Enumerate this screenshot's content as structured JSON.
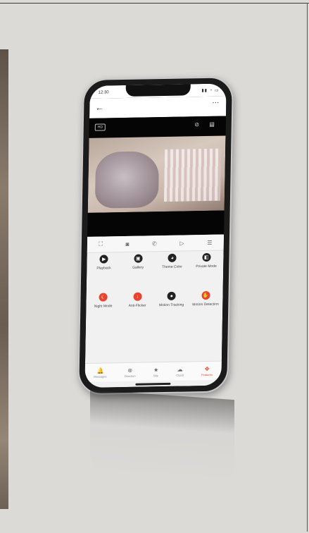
{
  "status_bar": {
    "time": "12:30",
    "icons": "▮▮ ◔ ▭"
  },
  "app_bar": {
    "back_glyph": "←",
    "more_glyph": "⋯"
  },
  "camera_header": {
    "quality_label": "HD",
    "icon_glyphs": "⊘ ▤"
  },
  "toolbar": {
    "items": [
      {
        "name": "fullscreen-icon",
        "glyph": "⛶"
      },
      {
        "name": "snapshot-icon",
        "glyph": "◙"
      },
      {
        "name": "call-icon",
        "glyph": "✆"
      },
      {
        "name": "record-icon",
        "glyph": "▷"
      },
      {
        "name": "menu-icon",
        "glyph": "☰"
      }
    ]
  },
  "features": [
    {
      "label": "Playback",
      "glyph": "▶",
      "accent": false
    },
    {
      "label": "Gallery",
      "glyph": "▣",
      "accent": false
    },
    {
      "label": "Theme Color",
      "glyph": "◕",
      "accent": false
    },
    {
      "label": "Private Mode",
      "glyph": "◧",
      "accent": false
    },
    {
      "label": "Night Mode",
      "glyph": "☾",
      "accent": true
    },
    {
      "label": "Anti-Flicker",
      "glyph": "↓",
      "accent": true
    },
    {
      "label": "Motion Tracking",
      "glyph": "●",
      "accent": false
    },
    {
      "label": "Motion Detection",
      "glyph": "✋",
      "accent": true
    }
  ],
  "tabs": [
    {
      "label": "Messages",
      "glyph": "🔔",
      "active": false
    },
    {
      "label": "Direction",
      "glyph": "⊗",
      "active": false
    },
    {
      "label": "Site",
      "glyph": "★",
      "active": false
    },
    {
      "label": "Cloud",
      "glyph": "☁",
      "active": false
    },
    {
      "label": "Features",
      "glyph": "✥",
      "active": true
    }
  ],
  "colors": {
    "accent": "#e8432f",
    "background": "#dcdad7"
  }
}
